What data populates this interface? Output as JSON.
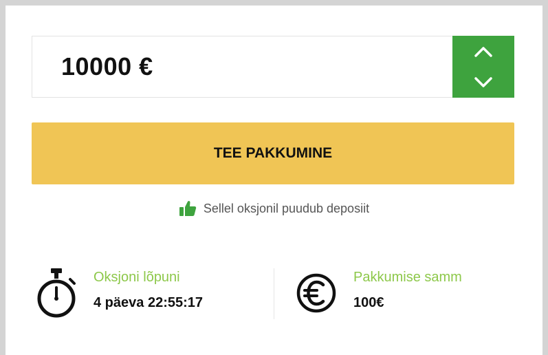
{
  "bid": {
    "amount": "10000 €"
  },
  "stepper": {
    "up_icon": "chevron-up-icon",
    "down_icon": "chevron-down-icon",
    "color": "#3ea33e"
  },
  "submit_button": {
    "label": "TEE PAKKUMINE",
    "color": "#f0c555"
  },
  "deposit_note": {
    "icon": "thumbs-up-icon",
    "text": "Sellel oksjonil puudub deposiit"
  },
  "auction_end": {
    "icon": "stopwatch-icon",
    "label": "Oksjoni lõpuni",
    "value": "4 päeva 22:55:17"
  },
  "bid_step": {
    "icon": "euro-icon",
    "label": "Pakkumise samm",
    "value": "100€"
  },
  "accent_label_color": "#8dc84a"
}
